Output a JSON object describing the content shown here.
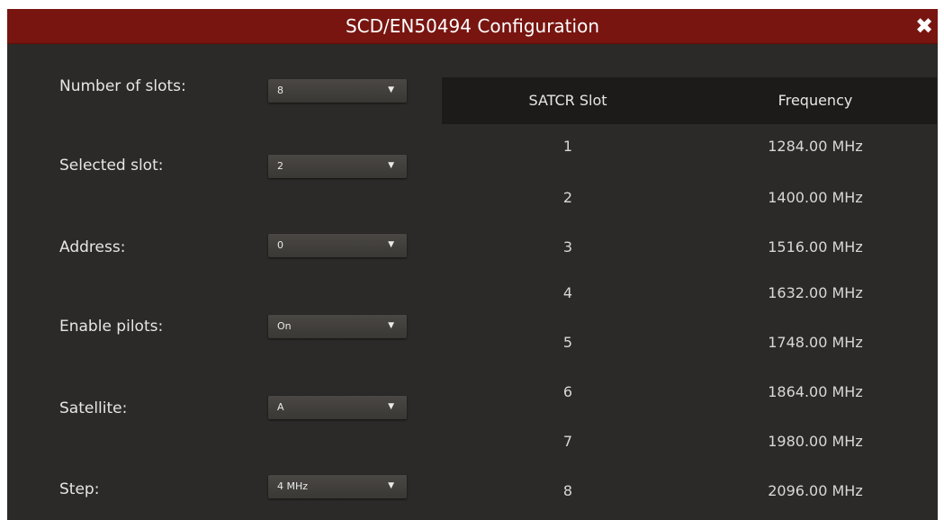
{
  "dialog": {
    "title": "SCD/EN50494 Configuration",
    "close_icon": "close-icon"
  },
  "form": {
    "fields": [
      {
        "label": "Number of slots:",
        "value": "8"
      },
      {
        "label": "Selected slot:",
        "value": "2"
      },
      {
        "label": "Address:",
        "value": "0"
      },
      {
        "label": "Enable pilots:",
        "value": "On"
      },
      {
        "label": "Satellite:",
        "value": "A"
      },
      {
        "label": "Step:",
        "value": "4 MHz"
      }
    ]
  },
  "table": {
    "headers": {
      "slot": "SATCR Slot",
      "frequency": "Frequency"
    },
    "rows": [
      {
        "slot": "1",
        "frequency": "1284.00 MHz"
      },
      {
        "slot": "2",
        "frequency": "1400.00 MHz"
      },
      {
        "slot": "3",
        "frequency": "1516.00 MHz"
      },
      {
        "slot": "4",
        "frequency": "1632.00 MHz"
      },
      {
        "slot": "5",
        "frequency": "1748.00 MHz"
      },
      {
        "slot": "6",
        "frequency": "1864.00 MHz"
      },
      {
        "slot": "7",
        "frequency": "1980.00 MHz"
      },
      {
        "slot": "8",
        "frequency": "2096.00 MHz"
      }
    ]
  },
  "colors": {
    "titlebar": "#781510",
    "panel": "#2c2a28",
    "table_header": "#1c1b1a"
  }
}
